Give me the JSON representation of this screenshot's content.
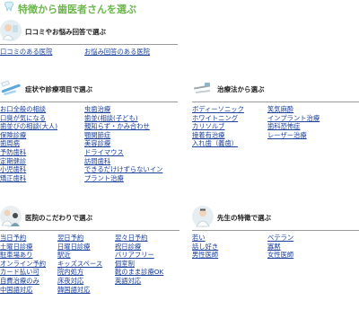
{
  "page_title": "特徴から歯医者さんを選ぶ",
  "colors": {
    "title": "#6bb64a",
    "link": "#1a3f9c",
    "divider": "#9a9a9a"
  },
  "sections": {
    "reviews": {
      "title": "口コミやお悩み回答で選ぶ",
      "icon": "doctor-portrait-icon",
      "col1": [
        "口コミのある医院"
      ],
      "col2": [
        "お悩み回答のある医院"
      ]
    },
    "symptoms": {
      "title": "症状や診療項目で選ぶ",
      "icon": "toothbrush-icon",
      "col1": [
        "お口全般の相談",
        "口臭が気になる",
        "歯並びの相談(大人)",
        "保険診療",
        "歯周病",
        "予防歯科",
        "定期健診",
        "小児歯科",
        "矯正歯科"
      ],
      "col2": [
        "虫歯治療",
        "歯並(相談(子ども)",
        "親知らず・かみ合わせ",
        "顎関節症",
        "美容診療",
        "ドライマウス",
        "訪問歯科",
        "できるだけけずらないイン",
        "プラント治療"
      ]
    },
    "treatments": {
      "title": "治療法から選ぶ",
      "icon": "dental-tools-icon",
      "col1": [
        "ボディーソニック",
        "ホワイトニング",
        "カリソルブ",
        "接着有治療",
        "入れ歯（義歯）"
      ],
      "col2": [
        "笑気麻酔",
        "インプラント治療",
        "歯科恐怖症",
        "レーザー治療"
      ]
    },
    "clinic": {
      "title": "医院のこだわりで選ぶ",
      "icon": "doctor-patient-icon",
      "col1": [
        "当日予約",
        "土曜日診療",
        "駐車場あり",
        "オンライン予約",
        "カード払い可",
        "自費治療のみ",
        "中国語対応"
      ],
      "col2": [
        "翌日予約",
        "日曜日診療",
        "駅近",
        "キッズスペース",
        "院内処方",
        "床夜対応",
        "韓国語対応"
      ],
      "col3": [
        "翌々日予約",
        "祝日診療",
        "バリアフリー",
        "個室制",
        "靴のまま診療OK",
        "英語対応"
      ]
    },
    "doctor": {
      "title": "先生の特徴で選ぶ",
      "icon": "dentist-icon",
      "col1": [
        "若い",
        "話し好き",
        "男性医師"
      ],
      "col2": [
        "ベテラン",
        "寡黙",
        "女性医師"
      ]
    }
  }
}
